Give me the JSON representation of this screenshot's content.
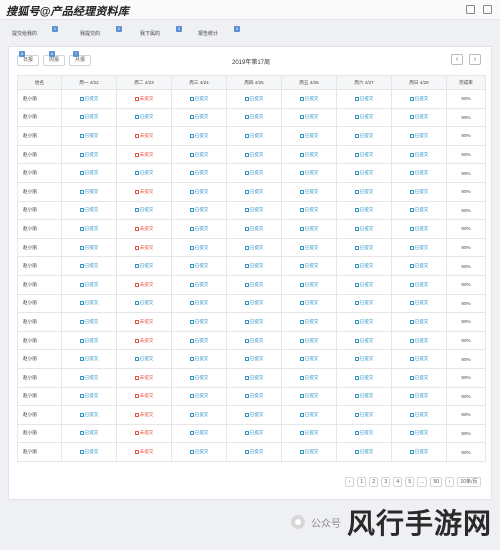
{
  "window": {
    "title": "搜狐号@产品经理资料库"
  },
  "tabs": [
    {
      "label": "提交给我的",
      "badge": "1"
    },
    {
      "label": "我提交的",
      "badge": "2"
    },
    {
      "label": "我下属的",
      "badge": "3"
    },
    {
      "label": "报告统计",
      "badge": "4"
    }
  ],
  "filters": [
    {
      "label": "日报",
      "badge": "5"
    },
    {
      "label": "周报",
      "badge": "6"
    },
    {
      "label": "月报",
      "badge": "7"
    }
  ],
  "week_title": "2019年第17周",
  "table": {
    "headers": [
      "姓名",
      "周一 4/22",
      "周二 4/23",
      "周三 4/24",
      "周四 4/25",
      "周五 4/26",
      "周六 4/27",
      "周日 4/28",
      "完成率"
    ],
    "status_labels": {
      "ok": "已提交",
      "no": "未提交"
    },
    "rows": [
      {
        "name": "赵小丽",
        "days": [
          "ok",
          "no",
          "ok",
          "ok",
          "ok",
          "ok",
          "ok"
        ],
        "rate": "90%"
      },
      {
        "name": "赵小丽",
        "days": [
          "ok",
          "ok",
          "ok",
          "ok",
          "ok",
          "ok",
          "ok"
        ],
        "rate": "90%"
      },
      {
        "name": "赵小丽",
        "days": [
          "ok",
          "no",
          "ok",
          "ok",
          "ok",
          "ok",
          "ok"
        ],
        "rate": "90%"
      },
      {
        "name": "赵小丽",
        "days": [
          "ok",
          "no",
          "ok",
          "ok",
          "ok",
          "ok",
          "ok"
        ],
        "rate": "90%"
      },
      {
        "name": "赵小丽",
        "days": [
          "ok",
          "ok",
          "ok",
          "ok",
          "ok",
          "ok",
          "ok"
        ],
        "rate": "90%"
      },
      {
        "name": "赵小丽",
        "days": [
          "ok",
          "no",
          "ok",
          "ok",
          "ok",
          "ok",
          "ok"
        ],
        "rate": "90%"
      },
      {
        "name": "赵小丽",
        "days": [
          "ok",
          "ok",
          "ok",
          "ok",
          "ok",
          "ok",
          "ok"
        ],
        "rate": "90%"
      },
      {
        "name": "赵小丽",
        "days": [
          "ok",
          "no",
          "ok",
          "ok",
          "ok",
          "ok",
          "ok"
        ],
        "rate": "90%"
      },
      {
        "name": "赵小丽",
        "days": [
          "ok",
          "no",
          "ok",
          "ok",
          "ok",
          "ok",
          "ok"
        ],
        "rate": "90%"
      },
      {
        "name": "赵小丽",
        "days": [
          "ok",
          "ok",
          "ok",
          "ok",
          "ok",
          "ok",
          "ok"
        ],
        "rate": "90%"
      },
      {
        "name": "赵小丽",
        "days": [
          "ok",
          "no",
          "ok",
          "ok",
          "ok",
          "ok",
          "ok"
        ],
        "rate": "90%"
      },
      {
        "name": "赵小丽",
        "days": [
          "ok",
          "ok",
          "ok",
          "ok",
          "ok",
          "ok",
          "ok"
        ],
        "rate": "90%"
      },
      {
        "name": "赵小丽",
        "days": [
          "ok",
          "no",
          "ok",
          "ok",
          "ok",
          "ok",
          "ok"
        ],
        "rate": "90%"
      },
      {
        "name": "赵小丽",
        "days": [
          "ok",
          "no",
          "ok",
          "ok",
          "ok",
          "ok",
          "ok"
        ],
        "rate": "90%"
      },
      {
        "name": "赵小丽",
        "days": [
          "ok",
          "ok",
          "ok",
          "ok",
          "ok",
          "ok",
          "ok"
        ],
        "rate": "90%"
      },
      {
        "name": "赵小丽",
        "days": [
          "ok",
          "no",
          "ok",
          "ok",
          "ok",
          "ok",
          "ok"
        ],
        "rate": "90%"
      },
      {
        "name": "赵小丽",
        "days": [
          "ok",
          "no",
          "ok",
          "ok",
          "ok",
          "ok",
          "ok"
        ],
        "rate": "90%"
      },
      {
        "name": "赵小丽",
        "days": [
          "ok",
          "no",
          "ok",
          "ok",
          "ok",
          "ok",
          "ok"
        ],
        "rate": "90%"
      },
      {
        "name": "赵小丽",
        "days": [
          "ok",
          "no",
          "ok",
          "ok",
          "ok",
          "ok",
          "ok"
        ],
        "rate": "90%"
      },
      {
        "name": "赵小丽",
        "days": [
          "ok",
          "no",
          "ok",
          "ok",
          "ok",
          "ok",
          "ok"
        ],
        "rate": "90%"
      }
    ]
  },
  "pagination": {
    "prev": "‹",
    "pages": [
      "1",
      "2",
      "3",
      "4",
      "5",
      "...",
      "50"
    ],
    "next": "›",
    "page_size": "10条/页"
  },
  "wechat": {
    "small_label": "公众号",
    "big_label": "风行手游网"
  },
  "colors": {
    "ok": "#2e93c8",
    "no": "#e0533e",
    "badge": "#5b8fd6"
  }
}
